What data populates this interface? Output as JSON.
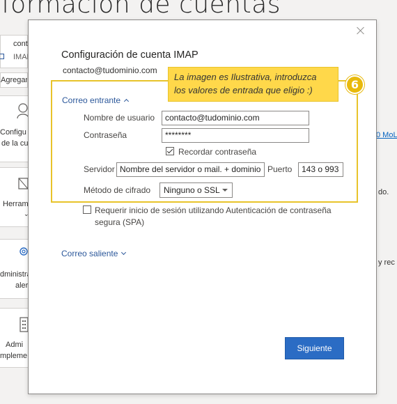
{
  "background": {
    "title": "formación de cuentas",
    "account": {
      "name": "cont",
      "type": "IMAP"
    },
    "add_button": "Agregar",
    "tiles": [
      {
        "line1": "Configu",
        "line2": "de la cu"
      },
      {
        "line1": "Herram",
        "line2": ""
      },
      {
        "line1": "dministra",
        "line2": "aler"
      },
      {
        "line1": "Admi",
        "line2": "mpleme"
      }
    ],
    "right_texts": [
      "0 MoL",
      "do.",
      "y rec"
    ]
  },
  "dialog": {
    "title": "Configuración de cuenta IMAP",
    "email": "contacto@tudominio.com",
    "incoming": {
      "toggle_label": "Correo entrante",
      "username_label": "Nombre de usuario",
      "username_value": "contacto@tudominio.com",
      "password_label": "Contraseña",
      "password_value": "********",
      "remember_label": "Recordar contraseña",
      "remember_checked": true,
      "server_label": "Servidor",
      "server_value": "Nombre del servidor o mail. + dominio",
      "port_label": "Puerto",
      "port_value": "143 o 993",
      "encryption_label": "Método de cifrado",
      "encryption_value": "Ninguno o SSL"
    },
    "spa_label_line1": "Requerir inicio de sesión utilizando Autenticación de contraseña",
    "spa_label_line2": "segura (SPA)",
    "spa_checked": false,
    "outgoing": {
      "toggle_label": "Correo saliente"
    },
    "next_button": "Siguiente"
  },
  "callout": {
    "line1": "La imagen es Ilustrativa, introduzca",
    "line2": "los valores de entrada que eligio  :)",
    "step": "6"
  },
  "colors": {
    "accent": "#2b6cc4",
    "highlight": "#e8c32a",
    "callout_bg": "#ffd84a",
    "link": "#2b579a"
  }
}
